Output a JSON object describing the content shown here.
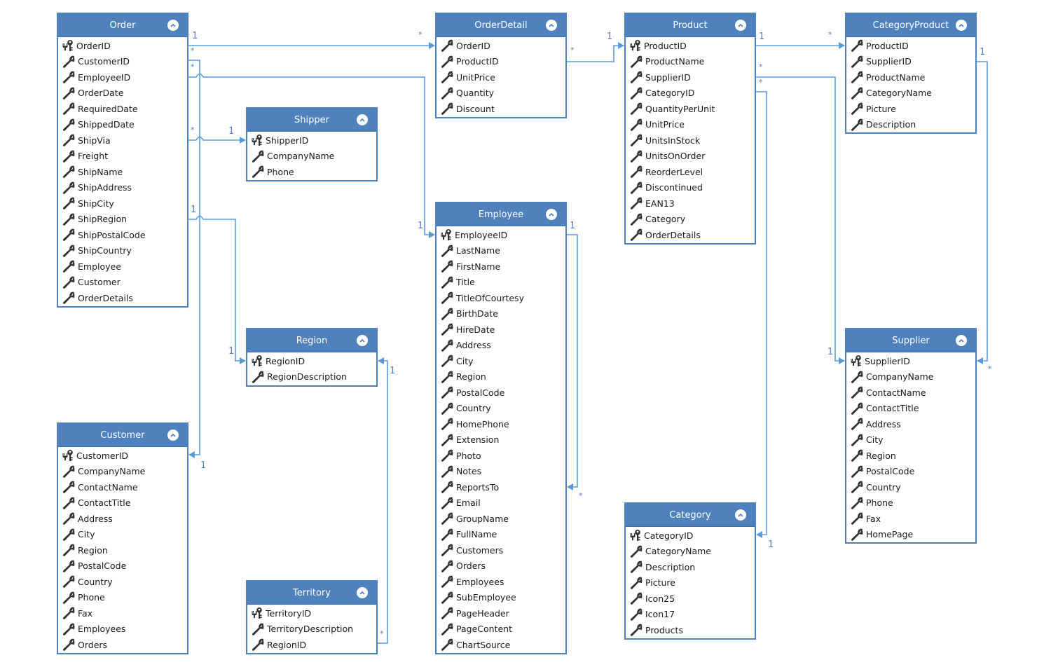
{
  "entities": {
    "order": {
      "title": "Order",
      "fields": [
        {
          "name": "OrderID",
          "key": true
        },
        {
          "name": "CustomerID",
          "key": false
        },
        {
          "name": "EmployeeID",
          "key": false
        },
        {
          "name": "OrderDate",
          "key": false
        },
        {
          "name": "RequiredDate",
          "key": false
        },
        {
          "name": "ShippedDate",
          "key": false
        },
        {
          "name": "ShipVia",
          "key": false
        },
        {
          "name": "Freight",
          "key": false
        },
        {
          "name": "ShipName",
          "key": false
        },
        {
          "name": "ShipAddress",
          "key": false
        },
        {
          "name": "ShipCity",
          "key": false
        },
        {
          "name": "ShipRegion",
          "key": false
        },
        {
          "name": "ShipPostalCode",
          "key": false
        },
        {
          "name": "ShipCountry",
          "key": false
        },
        {
          "name": "Employee",
          "key": false
        },
        {
          "name": "Customer",
          "key": false
        },
        {
          "name": "OrderDetails",
          "key": false
        }
      ]
    },
    "orderdetail": {
      "title": "OrderDetail",
      "fields": [
        {
          "name": "OrderID",
          "key": false
        },
        {
          "name": "ProductID",
          "key": false
        },
        {
          "name": "UnitPrice",
          "key": false
        },
        {
          "name": "Quantity",
          "key": false
        },
        {
          "name": "Discount",
          "key": false
        }
      ]
    },
    "product": {
      "title": "Product",
      "fields": [
        {
          "name": "ProductID",
          "key": true
        },
        {
          "name": "ProductName",
          "key": false
        },
        {
          "name": "SupplierID",
          "key": false
        },
        {
          "name": "CategoryID",
          "key": false
        },
        {
          "name": "QuantityPerUnit",
          "key": false
        },
        {
          "name": "UnitPrice",
          "key": false
        },
        {
          "name": "UnitsInStock",
          "key": false
        },
        {
          "name": "UnitsOnOrder",
          "key": false
        },
        {
          "name": "ReorderLevel",
          "key": false
        },
        {
          "name": "Discontinued",
          "key": false
        },
        {
          "name": "EAN13",
          "key": false
        },
        {
          "name": "Category",
          "key": false
        },
        {
          "name": "OrderDetails",
          "key": false
        }
      ]
    },
    "categoryproduct": {
      "title": "CategoryProduct",
      "fields": [
        {
          "name": "ProductID",
          "key": false
        },
        {
          "name": "SupplierID",
          "key": false
        },
        {
          "name": "ProductName",
          "key": false
        },
        {
          "name": "CategoryName",
          "key": false
        },
        {
          "name": "Picture",
          "key": false
        },
        {
          "name": "Description",
          "key": false
        }
      ]
    },
    "shipper": {
      "title": "Shipper",
      "fields": [
        {
          "name": "ShipperID",
          "key": true
        },
        {
          "name": "CompanyName",
          "key": false
        },
        {
          "name": "Phone",
          "key": false
        }
      ]
    },
    "employee": {
      "title": "Employee",
      "fields": [
        {
          "name": "EmployeeID",
          "key": true
        },
        {
          "name": "LastName",
          "key": false
        },
        {
          "name": "FirstName",
          "key": false
        },
        {
          "name": "Title",
          "key": false
        },
        {
          "name": "TitleOfCourtesy",
          "key": false
        },
        {
          "name": "BirthDate",
          "key": false
        },
        {
          "name": "HireDate",
          "key": false
        },
        {
          "name": "Address",
          "key": false
        },
        {
          "name": "City",
          "key": false
        },
        {
          "name": "Region",
          "key": false
        },
        {
          "name": "PostalCode",
          "key": false
        },
        {
          "name": "Country",
          "key": false
        },
        {
          "name": "HomePhone",
          "key": false
        },
        {
          "name": "Extension",
          "key": false
        },
        {
          "name": "Photo",
          "key": false
        },
        {
          "name": "Notes",
          "key": false
        },
        {
          "name": "ReportsTo",
          "key": false
        },
        {
          "name": "Email",
          "key": false
        },
        {
          "name": "GroupName",
          "key": false
        },
        {
          "name": "FullName",
          "key": false
        },
        {
          "name": "Customers",
          "key": false
        },
        {
          "name": "Orders",
          "key": false
        },
        {
          "name": "Employees",
          "key": false
        },
        {
          "name": "SubEmployee",
          "key": false
        },
        {
          "name": "PageHeader",
          "key": false
        },
        {
          "name": "PageContent",
          "key": false
        },
        {
          "name": "ChartSource",
          "key": false
        }
      ]
    },
    "region": {
      "title": "Region",
      "fields": [
        {
          "name": "RegionID",
          "key": true
        },
        {
          "name": "RegionDescription",
          "key": false
        }
      ]
    },
    "customer": {
      "title": "Customer",
      "fields": [
        {
          "name": "CustomerID",
          "key": true
        },
        {
          "name": "CompanyName",
          "key": false
        },
        {
          "name": "ContactName",
          "key": false
        },
        {
          "name": "ContactTitle",
          "key": false
        },
        {
          "name": "Address",
          "key": false
        },
        {
          "name": "City",
          "key": false
        },
        {
          "name": "Region",
          "key": false
        },
        {
          "name": "PostalCode",
          "key": false
        },
        {
          "name": "Country",
          "key": false
        },
        {
          "name": "Phone",
          "key": false
        },
        {
          "name": "Fax",
          "key": false
        },
        {
          "name": "Employees",
          "key": false
        },
        {
          "name": "Orders",
          "key": false
        }
      ]
    },
    "territory": {
      "title": "Territory",
      "fields": [
        {
          "name": "TerritoryID",
          "key": true
        },
        {
          "name": "TerritoryDescription",
          "key": false
        },
        {
          "name": "RegionID",
          "key": false
        }
      ]
    },
    "category": {
      "title": "Category",
      "fields": [
        {
          "name": "CategoryID",
          "key": true
        },
        {
          "name": "CategoryName",
          "key": false
        },
        {
          "name": "Description",
          "key": false
        },
        {
          "name": "Picture",
          "key": false
        },
        {
          "name": "Icon25",
          "key": false
        },
        {
          "name": "Icon17",
          "key": false
        },
        {
          "name": "Products",
          "key": false
        }
      ]
    },
    "supplier": {
      "title": "Supplier",
      "fields": [
        {
          "name": "SupplierID",
          "key": true
        },
        {
          "name": "CompanyName",
          "key": false
        },
        {
          "name": "ContactName",
          "key": false
        },
        {
          "name": "ContactTitle",
          "key": false
        },
        {
          "name": "Address",
          "key": false
        },
        {
          "name": "City",
          "key": false
        },
        {
          "name": "Region",
          "key": false
        },
        {
          "name": "PostalCode",
          "key": false
        },
        {
          "name": "Country",
          "key": false
        },
        {
          "name": "Phone",
          "key": false
        },
        {
          "name": "Fax",
          "key": false
        },
        {
          "name": "HomePage",
          "key": false
        }
      ]
    }
  },
  "relationships": [
    {
      "from": "Order",
      "to": "OrderDetail",
      "from_mult": "1",
      "to_mult": "*"
    },
    {
      "from": "Order",
      "to": "Customer",
      "from_mult": "*",
      "to_mult": "1"
    },
    {
      "from": "Order",
      "to": "Employee",
      "from_mult": "*",
      "to_mult": "1"
    },
    {
      "from": "Order",
      "to": "Shipper",
      "from_mult": "*",
      "to_mult": "1"
    },
    {
      "from": "Order",
      "to": "Region",
      "from_mult": "1",
      "to_mult": "1"
    },
    {
      "from": "OrderDetail",
      "to": "Product",
      "from_mult": "*",
      "to_mult": "1"
    },
    {
      "from": "Product",
      "to": "CategoryProduct",
      "from_mult": "1",
      "to_mult": "*"
    },
    {
      "from": "Product",
      "to": "Supplier",
      "from_mult": "*",
      "to_mult": "1"
    },
    {
      "from": "Product",
      "to": "Category",
      "from_mult": "*",
      "to_mult": "1"
    },
    {
      "from": "CategoryProduct",
      "to": "Supplier",
      "from_mult": "1",
      "to_mult": "*"
    },
    {
      "from": "Employee",
      "to": "Employee",
      "from_mult": "1",
      "to_mult": "*"
    },
    {
      "from": "Territory",
      "to": "Region",
      "from_mult": "*",
      "to_mult": "1"
    }
  ],
  "icons": {
    "primary_key": "key-icon",
    "field": "wrench-icon",
    "collapse": "chevron-up-icon"
  },
  "colors": {
    "header": "#4f81bd",
    "border": "#4f81bd",
    "connector": "#5b9bd5",
    "text": "#1a1a1a"
  }
}
